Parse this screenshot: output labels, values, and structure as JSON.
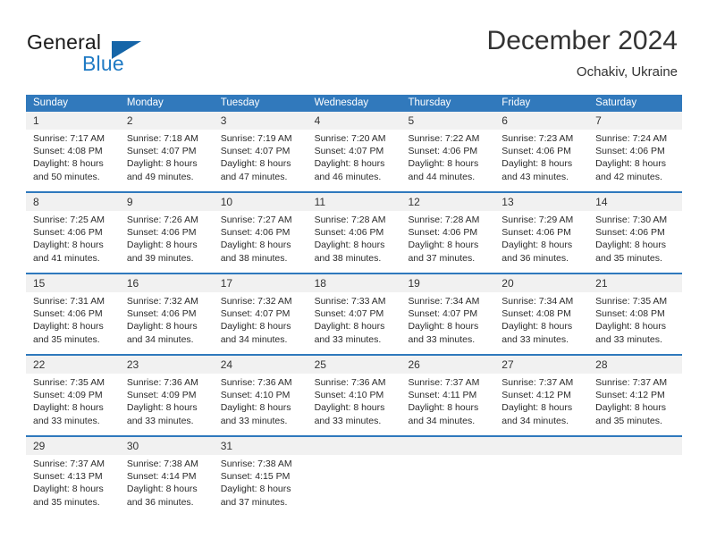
{
  "brand": {
    "name_part1": "General",
    "name_part2": "Blue"
  },
  "header": {
    "title": "December 2024",
    "location": "Ochakiv, Ukraine"
  },
  "calendar": {
    "weekdays": [
      "Sunday",
      "Monday",
      "Tuesday",
      "Wednesday",
      "Thursday",
      "Friday",
      "Saturday"
    ],
    "colors": {
      "header_blue": "#3179bc",
      "row_rule_blue": "#2f79bd",
      "daynum_band": "#f1f1f1",
      "brand_blue": "#1f7ac4"
    },
    "weeks": [
      [
        {
          "day": "1",
          "sunrise": "Sunrise: 7:17 AM",
          "sunset": "Sunset: 4:08 PM",
          "daylight1": "Daylight: 8 hours",
          "daylight2": "and 50 minutes."
        },
        {
          "day": "2",
          "sunrise": "Sunrise: 7:18 AM",
          "sunset": "Sunset: 4:07 PM",
          "daylight1": "Daylight: 8 hours",
          "daylight2": "and 49 minutes."
        },
        {
          "day": "3",
          "sunrise": "Sunrise: 7:19 AM",
          "sunset": "Sunset: 4:07 PM",
          "daylight1": "Daylight: 8 hours",
          "daylight2": "and 47 minutes."
        },
        {
          "day": "4",
          "sunrise": "Sunrise: 7:20 AM",
          "sunset": "Sunset: 4:07 PM",
          "daylight1": "Daylight: 8 hours",
          "daylight2": "and 46 minutes."
        },
        {
          "day": "5",
          "sunrise": "Sunrise: 7:22 AM",
          "sunset": "Sunset: 4:06 PM",
          "daylight1": "Daylight: 8 hours",
          "daylight2": "and 44 minutes."
        },
        {
          "day": "6",
          "sunrise": "Sunrise: 7:23 AM",
          "sunset": "Sunset: 4:06 PM",
          "daylight1": "Daylight: 8 hours",
          "daylight2": "and 43 minutes."
        },
        {
          "day": "7",
          "sunrise": "Sunrise: 7:24 AM",
          "sunset": "Sunset: 4:06 PM",
          "daylight1": "Daylight: 8 hours",
          "daylight2": "and 42 minutes."
        }
      ],
      [
        {
          "day": "8",
          "sunrise": "Sunrise: 7:25 AM",
          "sunset": "Sunset: 4:06 PM",
          "daylight1": "Daylight: 8 hours",
          "daylight2": "and 41 minutes."
        },
        {
          "day": "9",
          "sunrise": "Sunrise: 7:26 AM",
          "sunset": "Sunset: 4:06 PM",
          "daylight1": "Daylight: 8 hours",
          "daylight2": "and 39 minutes."
        },
        {
          "day": "10",
          "sunrise": "Sunrise: 7:27 AM",
          "sunset": "Sunset: 4:06 PM",
          "daylight1": "Daylight: 8 hours",
          "daylight2": "and 38 minutes."
        },
        {
          "day": "11",
          "sunrise": "Sunrise: 7:28 AM",
          "sunset": "Sunset: 4:06 PM",
          "daylight1": "Daylight: 8 hours",
          "daylight2": "and 38 minutes."
        },
        {
          "day": "12",
          "sunrise": "Sunrise: 7:28 AM",
          "sunset": "Sunset: 4:06 PM",
          "daylight1": "Daylight: 8 hours",
          "daylight2": "and 37 minutes."
        },
        {
          "day": "13",
          "sunrise": "Sunrise: 7:29 AM",
          "sunset": "Sunset: 4:06 PM",
          "daylight1": "Daylight: 8 hours",
          "daylight2": "and 36 minutes."
        },
        {
          "day": "14",
          "sunrise": "Sunrise: 7:30 AM",
          "sunset": "Sunset: 4:06 PM",
          "daylight1": "Daylight: 8 hours",
          "daylight2": "and 35 minutes."
        }
      ],
      [
        {
          "day": "15",
          "sunrise": "Sunrise: 7:31 AM",
          "sunset": "Sunset: 4:06 PM",
          "daylight1": "Daylight: 8 hours",
          "daylight2": "and 35 minutes."
        },
        {
          "day": "16",
          "sunrise": "Sunrise: 7:32 AM",
          "sunset": "Sunset: 4:06 PM",
          "daylight1": "Daylight: 8 hours",
          "daylight2": "and 34 minutes."
        },
        {
          "day": "17",
          "sunrise": "Sunrise: 7:32 AM",
          "sunset": "Sunset: 4:07 PM",
          "daylight1": "Daylight: 8 hours",
          "daylight2": "and 34 minutes."
        },
        {
          "day": "18",
          "sunrise": "Sunrise: 7:33 AM",
          "sunset": "Sunset: 4:07 PM",
          "daylight1": "Daylight: 8 hours",
          "daylight2": "and 33 minutes."
        },
        {
          "day": "19",
          "sunrise": "Sunrise: 7:34 AM",
          "sunset": "Sunset: 4:07 PM",
          "daylight1": "Daylight: 8 hours",
          "daylight2": "and 33 minutes."
        },
        {
          "day": "20",
          "sunrise": "Sunrise: 7:34 AM",
          "sunset": "Sunset: 4:08 PM",
          "daylight1": "Daylight: 8 hours",
          "daylight2": "and 33 minutes."
        },
        {
          "day": "21",
          "sunrise": "Sunrise: 7:35 AM",
          "sunset": "Sunset: 4:08 PM",
          "daylight1": "Daylight: 8 hours",
          "daylight2": "and 33 minutes."
        }
      ],
      [
        {
          "day": "22",
          "sunrise": "Sunrise: 7:35 AM",
          "sunset": "Sunset: 4:09 PM",
          "daylight1": "Daylight: 8 hours",
          "daylight2": "and 33 minutes."
        },
        {
          "day": "23",
          "sunrise": "Sunrise: 7:36 AM",
          "sunset": "Sunset: 4:09 PM",
          "daylight1": "Daylight: 8 hours",
          "daylight2": "and 33 minutes."
        },
        {
          "day": "24",
          "sunrise": "Sunrise: 7:36 AM",
          "sunset": "Sunset: 4:10 PM",
          "daylight1": "Daylight: 8 hours",
          "daylight2": "and 33 minutes."
        },
        {
          "day": "25",
          "sunrise": "Sunrise: 7:36 AM",
          "sunset": "Sunset: 4:10 PM",
          "daylight1": "Daylight: 8 hours",
          "daylight2": "and 33 minutes."
        },
        {
          "day": "26",
          "sunrise": "Sunrise: 7:37 AM",
          "sunset": "Sunset: 4:11 PM",
          "daylight1": "Daylight: 8 hours",
          "daylight2": "and 34 minutes."
        },
        {
          "day": "27",
          "sunrise": "Sunrise: 7:37 AM",
          "sunset": "Sunset: 4:12 PM",
          "daylight1": "Daylight: 8 hours",
          "daylight2": "and 34 minutes."
        },
        {
          "day": "28",
          "sunrise": "Sunrise: 7:37 AM",
          "sunset": "Sunset: 4:12 PM",
          "daylight1": "Daylight: 8 hours",
          "daylight2": "and 35 minutes."
        }
      ],
      [
        {
          "day": "29",
          "sunrise": "Sunrise: 7:37 AM",
          "sunset": "Sunset: 4:13 PM",
          "daylight1": "Daylight: 8 hours",
          "daylight2": "and 35 minutes."
        },
        {
          "day": "30",
          "sunrise": "Sunrise: 7:38 AM",
          "sunset": "Sunset: 4:14 PM",
          "daylight1": "Daylight: 8 hours",
          "daylight2": "and 36 minutes."
        },
        {
          "day": "31",
          "sunrise": "Sunrise: 7:38 AM",
          "sunset": "Sunset: 4:15 PM",
          "daylight1": "Daylight: 8 hours",
          "daylight2": "and 37 minutes."
        },
        {
          "day": "",
          "sunrise": "",
          "sunset": "",
          "daylight1": "",
          "daylight2": ""
        },
        {
          "day": "",
          "sunrise": "",
          "sunset": "",
          "daylight1": "",
          "daylight2": ""
        },
        {
          "day": "",
          "sunrise": "",
          "sunset": "",
          "daylight1": "",
          "daylight2": ""
        },
        {
          "day": "",
          "sunrise": "",
          "sunset": "",
          "daylight1": "",
          "daylight2": ""
        }
      ]
    ]
  }
}
